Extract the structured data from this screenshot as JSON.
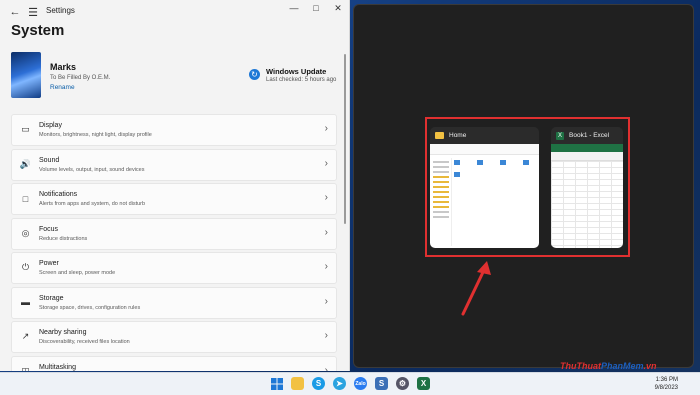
{
  "settings": {
    "app_title": "Settings",
    "page_title": "System",
    "profile": {
      "name": "Marks",
      "org": "To Be Filled By O.E.M.",
      "rename": "Rename"
    },
    "update": {
      "title": "Windows Update",
      "last_checked": "Last checked: 5 hours ago"
    },
    "items": [
      {
        "label": "Display",
        "desc": "Monitors, brightness, night light, display profile",
        "icon": "display-icon"
      },
      {
        "label": "Sound",
        "desc": "Volume levels, output, input, sound devices",
        "icon": "sound-icon"
      },
      {
        "label": "Notifications",
        "desc": "Alerts from apps and system, do not disturb",
        "icon": "notifications-icon"
      },
      {
        "label": "Focus",
        "desc": "Reduce distractions",
        "icon": "focus-icon"
      },
      {
        "label": "Power",
        "desc": "Screen and sleep, power mode",
        "icon": "power-icon"
      },
      {
        "label": "Storage",
        "desc": "Storage space, drives, configuration rules",
        "icon": "storage-icon"
      },
      {
        "label": "Nearby sharing",
        "desc": "Discoverability, received files location",
        "icon": "share-icon"
      },
      {
        "label": "Multitasking",
        "desc": "",
        "icon": "multitasking-icon"
      }
    ]
  },
  "snap": {
    "windows": [
      {
        "title": "Home",
        "icon": "folder-icon"
      },
      {
        "title": "Book1 - Excel",
        "icon": "excel-icon"
      }
    ],
    "highlight_color": "#e03030"
  },
  "taskbar": {
    "time": "1:36 PM",
    "date": "9/8/2023"
  },
  "watermark": {
    "part1": "ThuThuat",
    "part2": "PhanMem",
    "part3": ".vn"
  }
}
